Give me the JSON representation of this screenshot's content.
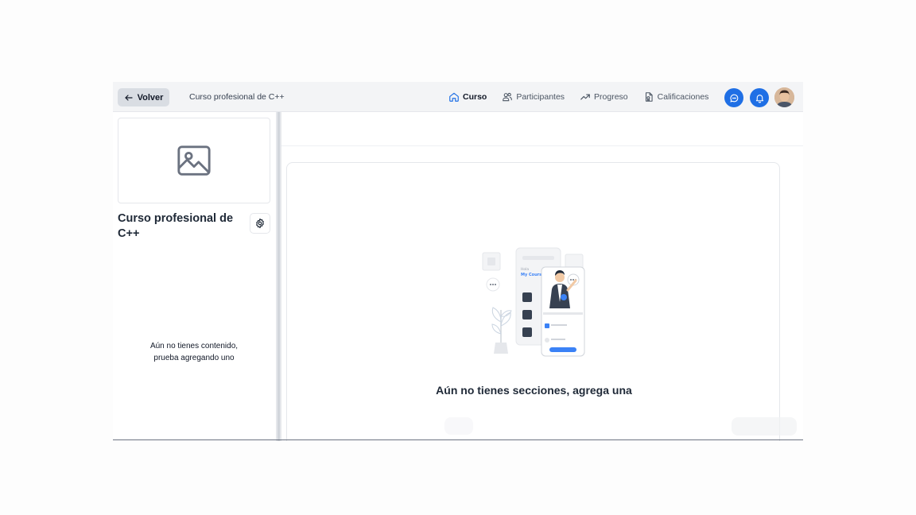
{
  "topbar": {
    "back_label": "Volver",
    "course_name": "Curso profesional de C++",
    "nav": [
      {
        "label": "Curso",
        "icon": "home-icon"
      },
      {
        "label": "Participantes",
        "icon": "users-icon"
      },
      {
        "label": "Progreso",
        "icon": "trending-up-icon"
      },
      {
        "label": "Calificaciones",
        "icon": "grades-icon"
      }
    ],
    "accent": "#1f6fe5"
  },
  "sidebar": {
    "title": "Curso profesional de C++",
    "empty_line1": "Aún no tienes contenido,",
    "empty_line2": "prueba agregando uno"
  },
  "main": {
    "empty_message": "Aún no tienes secciones, agrega una"
  }
}
